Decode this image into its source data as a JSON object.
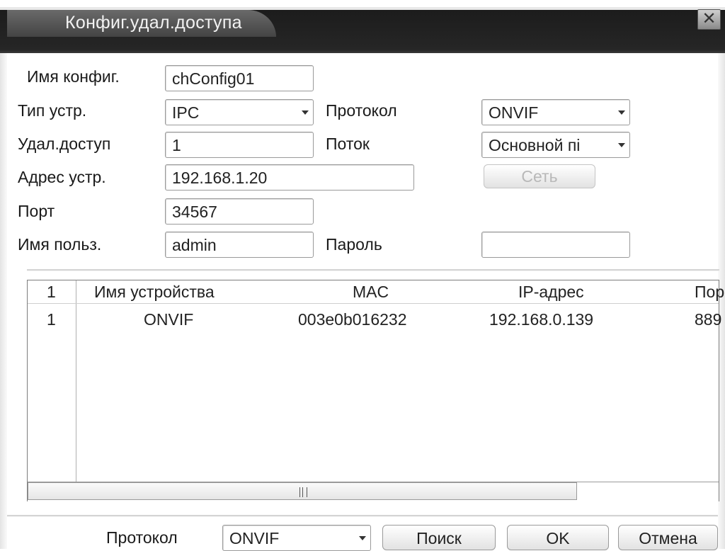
{
  "window": {
    "title": "Конфиг.удал.доступа",
    "close_glyph": "✕"
  },
  "form": {
    "config_name_label": "Имя конфиг.",
    "config_name_value": "chConfig01",
    "device_type_label": "Тип устр.",
    "device_type_value": "IPC",
    "protocol_label": "Протокол",
    "protocol_value": "ONVIF",
    "remote_channel_label": "Удал.доступ",
    "remote_channel_value": "1",
    "stream_label": "Поток",
    "stream_value": "Основной пі",
    "device_address_label": "Адрес устр.",
    "device_address_value": "192.168.1.20",
    "network_button": "Сеть",
    "port_label": "Порт",
    "port_value": "34567",
    "username_label": "Имя польз.",
    "username_value": "admin",
    "password_label": "Пароль",
    "password_value": ""
  },
  "device_table": {
    "columns": [
      "1",
      "Имя устройства",
      "MAC",
      "IP-адрес",
      "Пор"
    ],
    "rows": [
      [
        "1",
        "ONVIF",
        "003e0b016232",
        "192.168.0.139",
        "889"
      ]
    ]
  },
  "footer": {
    "protocol_label": "Протокол",
    "protocol_value": "ONVIF",
    "search_button": "Поиск",
    "ok_button": "OK",
    "cancel_button": "Отмена"
  }
}
